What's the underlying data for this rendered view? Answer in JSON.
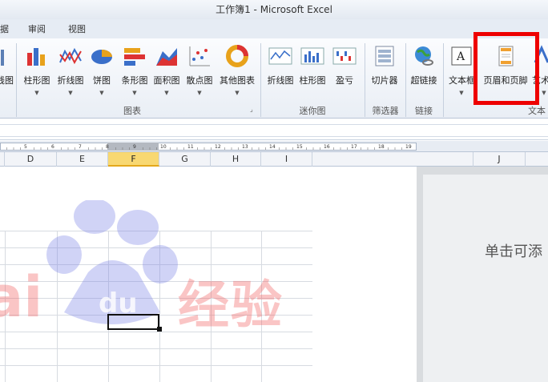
{
  "window": {
    "title": "工作簿1 - Microsoft Excel"
  },
  "tabs": [
    "据",
    "审阅",
    "视图"
  ],
  "ribbon": {
    "buttons": [
      {
        "key": "pic",
        "label": "线图",
        "dropdown": false
      },
      {
        "key": "bar",
        "label": "柱形图",
        "dropdown": true
      },
      {
        "key": "line",
        "label": "折线图",
        "dropdown": true
      },
      {
        "key": "pie",
        "label": "饼图",
        "dropdown": true
      },
      {
        "key": "hbar",
        "label": "条形图",
        "dropdown": true
      },
      {
        "key": "area",
        "label": "面积图",
        "dropdown": true
      },
      {
        "key": "scatter",
        "label": "散点图",
        "dropdown": true
      },
      {
        "key": "other",
        "label": "其他图表",
        "dropdown": true
      },
      {
        "key": "spark-line",
        "label": "折线图",
        "dropdown": false
      },
      {
        "key": "spark-bar",
        "label": "柱形图",
        "dropdown": false
      },
      {
        "key": "spark-win",
        "label": "盈亏",
        "dropdown": false
      },
      {
        "key": "slicer",
        "label": "切片器",
        "dropdown": false
      },
      {
        "key": "hyperlink",
        "label": "超链接",
        "dropdown": false
      },
      {
        "key": "textbox",
        "label": "文本框",
        "dropdown": true
      },
      {
        "key": "headerfooter",
        "label": "页眉和页脚",
        "dropdown": false
      },
      {
        "key": "wordart",
        "label": "艺术",
        "dropdown": true
      }
    ],
    "groups": [
      "图表",
      "迷你图",
      "筛选器",
      "链接",
      "文本"
    ]
  },
  "ruler": {
    "labels": [
      "5",
      "6",
      "7",
      "8",
      "9",
      "10",
      "11",
      "12",
      "13",
      "14",
      "15",
      "16",
      "17",
      "18",
      "19"
    ]
  },
  "columns": [
    "D",
    "E",
    "F",
    "G",
    "H",
    "I",
    "J"
  ],
  "selected_column": "F",
  "right_page": {
    "placeholder": "单击可添"
  },
  "watermark": {
    "logo": "ai",
    "text": "经验"
  },
  "colors": {
    "accent": "#ee0000",
    "selected_col": "#f8d872"
  }
}
